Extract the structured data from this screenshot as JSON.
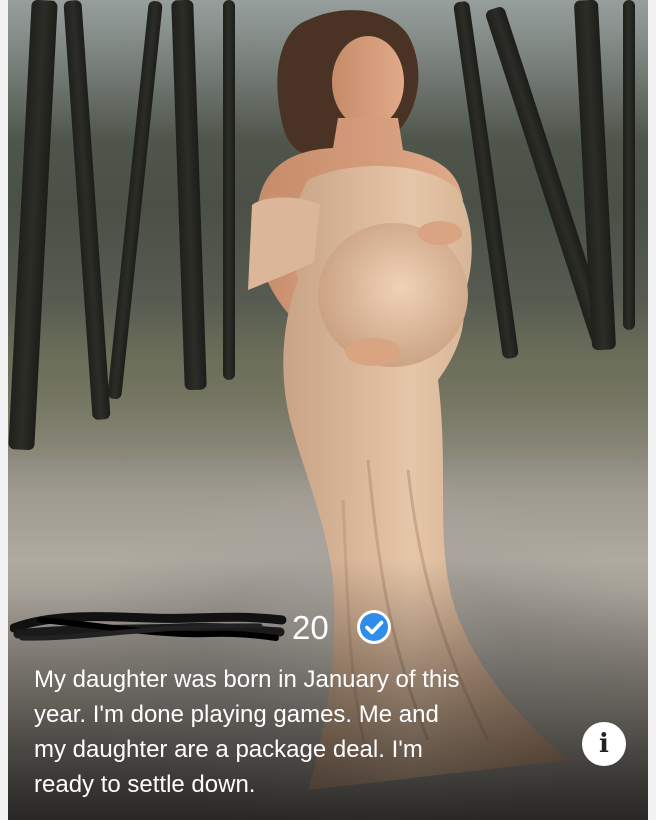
{
  "profile": {
    "age": "20",
    "verified_icon": "verified-check-icon",
    "bio": "My daughter was born in January of this\nyear. I'm done playing games. Me and\nmy daughter are a package deal. I'm\nready to settle down.",
    "info_icon": "info-icon",
    "info_glyph": "i"
  },
  "photo": {
    "subject": "pregnant-woman-in-blush-gown",
    "colors": {
      "gown": "#dcb89a",
      "verified_badge": "#2e8de8",
      "text": "#ffffff"
    }
  }
}
